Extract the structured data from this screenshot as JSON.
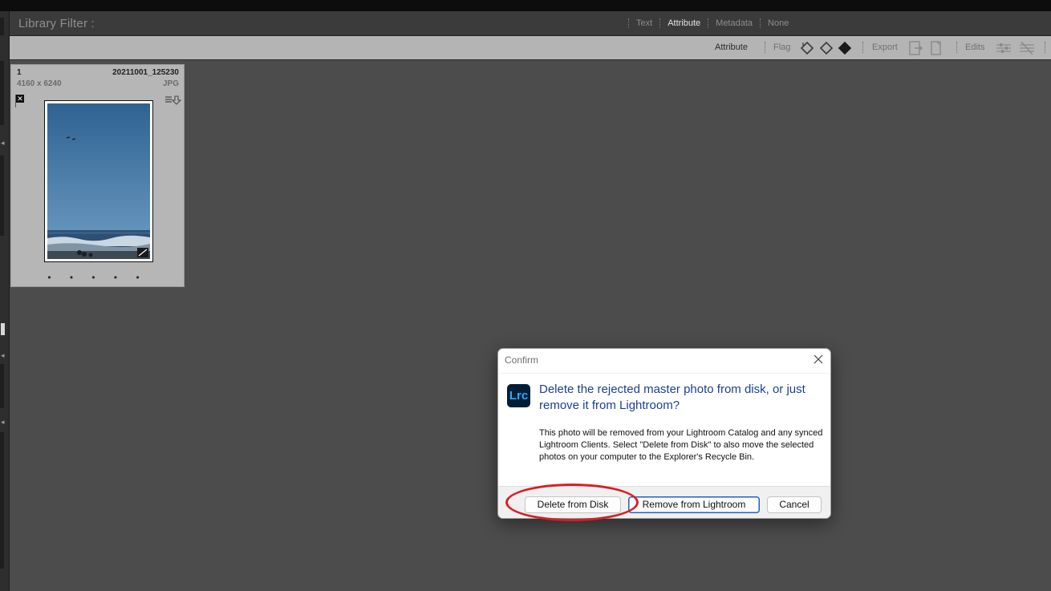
{
  "filter_bar": {
    "title": "Library Filter :",
    "tabs": [
      {
        "label": "Text",
        "active": false
      },
      {
        "label": "Attribute",
        "active": true
      },
      {
        "label": "Metadata",
        "active": false
      },
      {
        "label": "None",
        "active": false
      }
    ]
  },
  "attribute_bar": {
    "label": "Attribute",
    "flag_label": "Flag",
    "export_label": "Export",
    "edits_label": "Edits"
  },
  "grid": {
    "photos": [
      {
        "index": "1",
        "filename": "20211001_125230",
        "dimensions": "4160 x 6240",
        "filetype": "JPG",
        "flag": "rejected",
        "rating_dots": "• • • • •"
      }
    ]
  },
  "dialog": {
    "title": "Confirm",
    "app_logo_text": "Lrc",
    "heading": "Delete the rejected master photo from disk, or just remove it from Lightroom?",
    "message": "This photo will be removed from your Lightroom Catalog and any synced Lightroom Clients. Select \"Delete from Disk\" to also move the selected photos on your computer to the Explorer's Recycle Bin.",
    "buttons": {
      "delete_from_disk": "Delete from Disk",
      "remove_from_lightroom": "Remove from Lightroom",
      "cancel": "Cancel"
    }
  },
  "colors": {
    "highlight_ring": "#d61f26",
    "heading": "#1c3f8f",
    "logo_bg": "#001e36",
    "logo_fg": "#31a8ff"
  }
}
